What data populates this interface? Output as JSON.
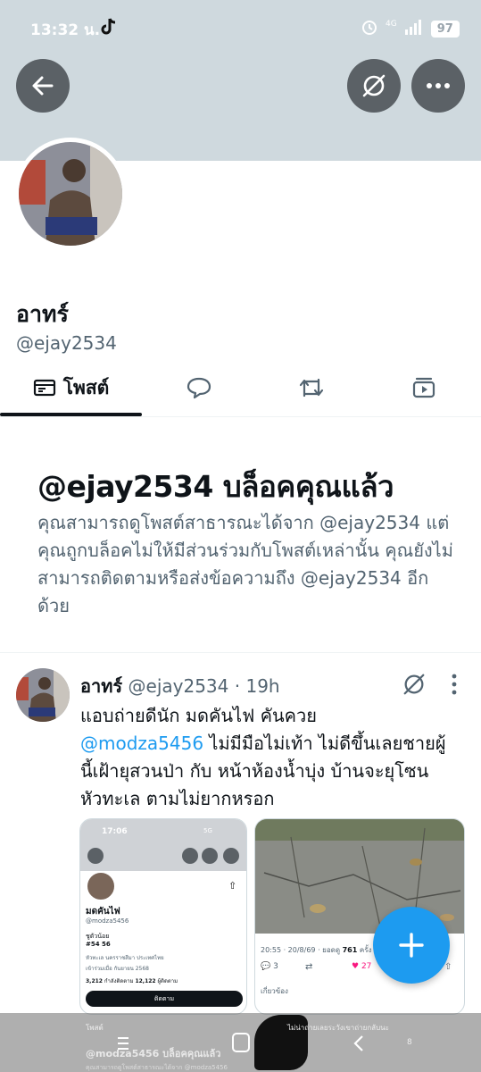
{
  "status_bar": {
    "time": "13:32 น.",
    "network": "4G",
    "battery": "97"
  },
  "profile": {
    "name": "อาทร์",
    "handle": "@ejay2534"
  },
  "tabs": [
    {
      "label": "โพสต์",
      "icon": "posts-icon",
      "selected": true
    },
    {
      "label": "",
      "icon": "reply-icon",
      "selected": false
    },
    {
      "label": "",
      "icon": "repost-icon",
      "selected": false
    },
    {
      "label": "",
      "icon": "media-icon",
      "selected": false
    }
  ],
  "blocked": {
    "title": "@ejay2534 บล็อคคุณแล้ว",
    "description": "คุณสามารถดูโพสต์สาธารณะได้จาก @ejay2534 แต่คุณถูกบล็อคไม่ให้มีส่วนร่วมกับโพสต์เหล่านั้น คุณยังไม่สามารถติดตามหรือส่งข้อความถึง @ejay2534 อีกด้วย"
  },
  "post": {
    "author_name": "อาทร์",
    "author_handle": "@ejay2534",
    "separator": "·",
    "time": "19h",
    "text_line1": "แอบถ่ายดีนัก มดคันไฟ คันควย",
    "mention": "@modza5456",
    "text_line2_rest": " ไม่มีมือไม่เท้า ไม่ดีขึ้นเลยชายผู้",
    "text_line3": "นี้เฝ้ายุสวนป่า กับ หน้าห้องน้ำบุ่ง บ้านจะยุโซน",
    "text_line4": "หัวทะเล ตามไม่ยากหรอก"
  },
  "embedded_left": {
    "time": "17:06",
    "network": "5G",
    "profile_name": "มดคันไฟ",
    "profile_handle": "@modza5456",
    "bio_line1": "ชูตัวน้อย",
    "bio_line2": "#54 56",
    "location": "หัวทะเล นครราชสีมา ประเทศไทย",
    "joined": "เข้าร่วมเมื่อ กันยายน 2568",
    "following_count": "3,212",
    "following_label": "กำลังติดตาม",
    "followers_count": "12,122",
    "followers_label": "ผู้ติดตาม",
    "follow_button": "ติดตาม",
    "tab_posts": "โพสต์",
    "blocked_text": "@modza5456 บล็อคคุณแล้ว",
    "blocked_desc": "คุณสามารถดูโพสต์สาธารณะได้จาก @modza5456"
  },
  "embedded_right": {
    "meta": "20:55 · 20/8/69 · ยอดดู",
    "views": "761",
    "views_unit": "ครั้ง",
    "replies": "3",
    "likes": "27",
    "related": "เกี่ยวข้อง",
    "reply_preview": "ไม่น่าถ่ายเลยระวังเขาถ่ายกลับนะ",
    "stat": "8"
  }
}
